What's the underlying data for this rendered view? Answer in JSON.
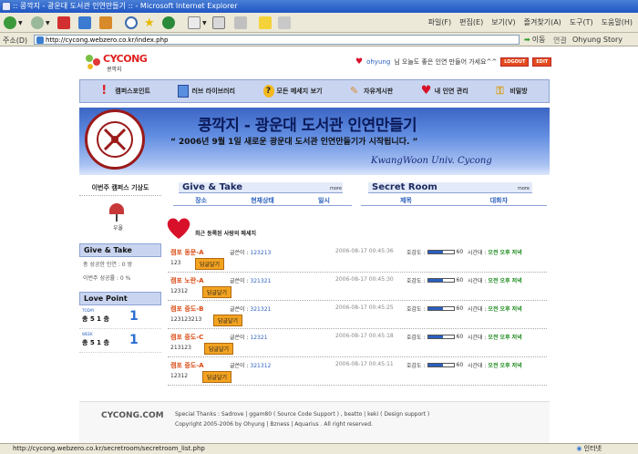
{
  "window": {
    "title": ":: 콩깍지 - 광운대 도서관 인연만들기 :: - Microsoft Internet Explorer"
  },
  "toolbar": {
    "back": "",
    "forward": ""
  },
  "menus": [
    "파일(F)",
    "편집(E)",
    "보기(V)",
    "즐겨찾기(A)",
    "도구(T)",
    "도움말(H)"
  ],
  "address": {
    "label": "주소(D)",
    "url": "http://cycong.webzero.co.kr/index.php",
    "go": "이동",
    "links_label": "연결",
    "link": "Ohyung Story"
  },
  "header": {
    "logo_text": "CYCONG",
    "logo_sub": "콩깍지",
    "user": "ohyung",
    "greeting": "님 오늘도 좋은 인연 만들어 가세요^^",
    "logout": "LOGOUT",
    "edit": "EDIT"
  },
  "nav": [
    {
      "label": "캠퍼스포인트",
      "icon": "exclamation-icon"
    },
    {
      "label": "러브 라이브러리",
      "icon": "cube-icon"
    },
    {
      "label": "모든 메세지 보기",
      "icon": "question-icon"
    },
    {
      "label": "자유게시판",
      "icon": "pencil-icon"
    },
    {
      "label": "내 인연 관리",
      "icon": "heart-icon"
    },
    {
      "label": "비밀방",
      "icon": "key-icon"
    }
  ],
  "banner": {
    "title": "콩깍지 - 광운대 도서관 인연만들기",
    "subtitle": "“ 2006년 9월 1일 새로운 광운대 도서관 인연만들기가 시작됩니다. ”",
    "english": "KwangWoon Univ. Cycong"
  },
  "sidebar": {
    "campus_title": "이번주 캠퍼스 기상도",
    "weather": "우울",
    "give_take_title": "Give & Take",
    "give_take_lines": [
      "총 성공한 인연 : 0 쌍",
      "이번주 성공률 : 0 %"
    ],
    "love_point_title": "Love Point",
    "love_points": [
      {
        "period": "TODAY",
        "name": "총 5 1 층",
        "value": "1"
      },
      {
        "period": "WEEK",
        "name": "총 5 1 층",
        "value": "1"
      }
    ]
  },
  "give_take": {
    "title": "Give & Take",
    "more": "more",
    "columns": [
      "장소",
      "현재상태",
      "일시"
    ]
  },
  "secret_room": {
    "title": "Secret Room",
    "more": "more",
    "columns": [
      "제목",
      "대화자"
    ]
  },
  "recent": {
    "label": "최근 등록된 사랑의 메세지"
  },
  "messages": [
    {
      "src": "캠포 동문-A",
      "label": "글쓴이 :",
      "num": "123213",
      "date": "2006-08-17 00:45:36",
      "like_label": "호감도 :",
      "like_pct": 60,
      "like_text": "60",
      "time_label": "시간대 :",
      "time_value": "오전 오후 저녁",
      "text": "123",
      "reply": "답글달기"
    },
    {
      "src": "캠포 노란-A",
      "label": "글쓴이 :",
      "num": "321321",
      "date": "2006-08-17 00:45:30",
      "like_label": "호감도 :",
      "like_pct": 60,
      "like_text": "60",
      "time_label": "시간대 :",
      "time_value": "오전 오후 저녁",
      "text": "12312",
      "reply": "답글달기"
    },
    {
      "src": "캠포 중도-B",
      "label": "글쓴이 :",
      "num": "321321",
      "date": "2006-08-17 00:45:25",
      "like_label": "호감도 :",
      "like_pct": 60,
      "like_text": "60",
      "time_label": "시간대 :",
      "time_value": "오전 오후 저녁",
      "text": "123123213",
      "reply": "답글달기"
    },
    {
      "src": "캠포 중도-C",
      "label": "글쓴이 :",
      "num": "12321",
      "date": "2006-08-17 00:45:18",
      "like_label": "호감도 :",
      "like_pct": 60,
      "like_text": "60",
      "time_label": "시간대 :",
      "time_value": "오전 오후 저녁",
      "text": "213123",
      "reply": "답글달기"
    },
    {
      "src": "캠포 중도-A",
      "label": "글쓴이 :",
      "num": "321312",
      "date": "2006-08-17 00:45:11",
      "like_label": "호감도 :",
      "like_pct": 60,
      "like_text": "60",
      "time_label": "시간대 :",
      "time_value": "오전 오후 저녁",
      "text": "12312",
      "reply": "답글달기"
    }
  ],
  "footer": {
    "logo": "CYCONG.COM",
    "line1": "Special Thanks : Sadrove | ggam80 ( Source Code Support ) , beatto | keki ( Design support )",
    "line2": "Copyright 2005-2006 by Ohyung | Bzness | Aquarius . All right reserved."
  },
  "status": {
    "url": "http://cycong.webzero.co.kr/secretroom/secretroom_list.php",
    "zone": "인터넷"
  }
}
